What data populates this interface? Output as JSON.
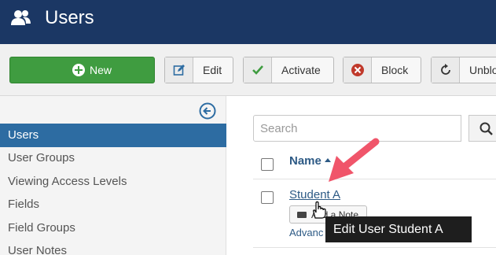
{
  "header": {
    "title": "Users",
    "icon": "users-icon"
  },
  "toolbar": {
    "new_label": "New",
    "edit_label": "Edit",
    "activate_label": "Activate",
    "block_label": "Block",
    "unblock_label": "Unblo"
  },
  "sidebar": {
    "items": [
      {
        "label": "Users",
        "active": true
      },
      {
        "label": "User Groups"
      },
      {
        "label": "Viewing Access Levels"
      },
      {
        "label": "Fields"
      },
      {
        "label": "Field Groups"
      },
      {
        "label": "User Notes"
      }
    ]
  },
  "search": {
    "placeholder": "Search"
  },
  "table": {
    "column_name": "Name",
    "rows": [
      {
        "name": "Student A",
        "note_label": "Add a Note",
        "advanced_label": "Advanc"
      }
    ]
  },
  "tooltip": {
    "text": "Edit User Student A"
  },
  "colors": {
    "header": "#1b3764",
    "new_button": "#3f9c40",
    "active_item": "#2d6ca2",
    "annotation_arrow": "#f0556a"
  }
}
